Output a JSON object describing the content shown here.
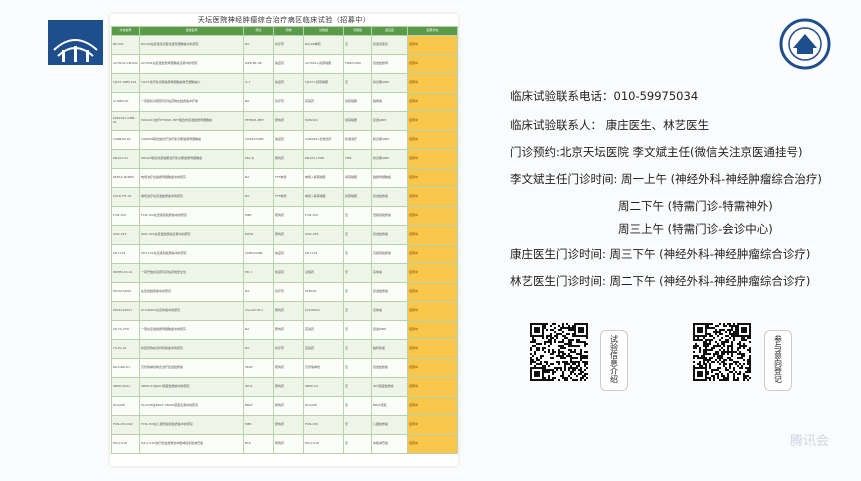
{
  "doc": {
    "title": "天坛医院神经肿瘤综合治疗病区临床试验（招募中）",
    "header_cols": [
      "方案编号",
      "试验名称",
      "靶点",
      "药物",
      "试验组",
      "对照组",
      "适应症",
      "招募状态"
    ],
    "rows": [
      [
        "NP-001",
        "RA106在复发性间变性星形细胞瘤中的研究",
        "NA",
        "化疗药",
        "RA106单药",
        "无",
        "复发间变性",
        "招募中"
      ],
      [
        "ACTOO1-CN-002",
        "ACT001在复发胶质母细胞瘤患者中的研究",
        "IKKβ,NF-κB",
        "免疫药",
        "ACT001+替莫唑胺",
        "TMZ/CCNU",
        "复发胶质母",
        "招募中"
      ],
      [
        "TJ107-GBM-201",
        "TJ107治疗新诊断胶质母细胞瘤淋巴细胞减少",
        "IL-7",
        "免疫药",
        "TJ107+替莫唑胺",
        "无",
        "新诊断GBM",
        "招募中"
      ],
      [
        "LY-GBM-01",
        "一项随机对照研究评估药物在胶质瘤中疗效",
        "NA",
        "化疗药",
        "实验药",
        "替莫唑胺",
        "胶质瘤",
        "招募中"
      ],
      [
        "PLB1001-GBM-01",
        "PLB1001治疗PTPRZ1-MET融合的复发胶质母细胞瘤",
        "PTPRZ1-MET",
        "靶向药",
        "PLB1001",
        "替莫唑胺",
        "复发GBM",
        "招募中"
      ],
      [
        "CANBAN-02",
        "CAN008联合放化疗治疗新诊断胶质母细胞瘤",
        "CD95/CD95L",
        "免疫药",
        "CAN008+标准治疗",
        "标准治疗",
        "新诊断GBM",
        "招募中"
      ],
      [
        "DB102-01",
        "DB102联合替莫唑胺治疗新诊断胶质母细胞瘤",
        "PKC-β",
        "靶向药",
        "DB102+TMZ",
        "TMZ",
        "新诊断GBM",
        "招募中"
      ],
      [
        "PKHLS-RCDRV",
        "电场治疗在胶质母细胞瘤中的研究",
        "NA",
        "TTF电场",
        "电场+替莫唑胺",
        "替莫唑胺",
        "胶质母细胞瘤",
        "招募中"
      ],
      [
        "2018-TTF-01",
        "电场治疗在复发胶质瘤中的研究",
        "NA",
        "TTF电场",
        "电场+替莫唑胺",
        "替莫唑胺",
        "复发胶质瘤",
        "招募中"
      ],
      [
        "FCN-159",
        "FCN-159在低级别胶质瘤中的研究",
        "MEK",
        "靶向药",
        "FCN-159",
        "无",
        "低级别胶质瘤",
        "招募中"
      ],
      [
        "GNC-015",
        "GNC-035在复发胶质瘤患者中的研究",
        "EGFR",
        "靶向药",
        "GNC-035",
        "无",
        "复发胶质瘤",
        "招募中"
      ],
      [
        "SDT-101",
        "SDT-101在高级别胶质瘤中的研究",
        "CD80/CD86",
        "免疫药",
        "SDT-101",
        "无",
        "高级别胶质瘤",
        "招募中"
      ],
      [
        "PWHM-03-01",
        "一项开放标签研究评估药物安全性",
        "PD-1",
        "免疫药",
        "试验药",
        "无",
        "实体瘤",
        "招募中"
      ],
      [
        "WLHA-TRAN",
        "在复发胶质瘤中的研究",
        "NA",
        "化疗药",
        "STB401",
        "无",
        "复发胶质瘤",
        "招募中"
      ],
      [
        "KPCKY10001",
        "KY100001在实体瘤中的研究",
        "Claudin18.2",
        "靶向药",
        "KY100001",
        "无",
        "实体瘤",
        "招募中"
      ],
      [
        "AP-7C-CTD",
        "一项在复发胶质母细胞瘤中的研究",
        "NA",
        "靶向药",
        "实验药",
        "无",
        "复发GBM",
        "招募中"
      ],
      [
        "YS-ZL-01",
        "新型药物在颅内转移瘤中的研究",
        "NA",
        "化疗药",
        "实验药",
        "无",
        "脑转移瘤",
        "招募中"
      ],
      [
        "BG-DRG-01",
        "贝伐珠单抗联合治疗复发胶质瘤",
        "VEGF",
        "靶向药",
        "贝伐珠单抗",
        "无",
        "复发胶质瘤",
        "招募中"
      ],
      [
        "ABSD-0001",
        "ABSD-01在IDH突变胶质瘤中的研究",
        "IDH1",
        "靶向药",
        "ABSD-01",
        "无",
        "IDH突变胶质瘤",
        "招募中"
      ],
      [
        "HLX208",
        "HLX208在BRAF V600E突变患者中的研究",
        "BRAF",
        "靶向药",
        "HLX208",
        "无",
        "BRAF突变",
        "招募中"
      ],
      [
        "FCN-159-002",
        "FCN-159在儿童低级别胶质瘤中的研究",
        "MEK",
        "靶向药",
        "FCN-159",
        "无",
        "儿童胶质瘤",
        "招募中"
      ],
      [
        "HZ-A-018",
        "HZ-A-018治疗复发或难治中枢神经系统淋巴瘤",
        "BTK",
        "靶向药",
        "HZ-A-018",
        "无",
        "中枢淋巴瘤",
        "招募中"
      ]
    ]
  },
  "contact": {
    "phone": "临床试验联系电话：010-59975034",
    "contacts": "临床试验联系人：   康庄医生、林艺医生",
    "appointment": "门诊预约:北京天坛医院 李文斌主任(微信关注京医通挂号)",
    "li_line1": "李文斌主任门诊时间:   周一上午   (神经外科-神经肿瘤综合治疗)",
    "li_line2": "周二下午   (特需门诊-特需神外)",
    "li_line3": "周三上午   (特需门诊-会诊中心)",
    "kang_line": "康庄医生门诊时间:   周三下午   (神经外科-神经肿瘤综合诊疗)",
    "lin_line": "林艺医生门诊时间:   周二下午   (神经外科-神经肿瘤综合诊疗)"
  },
  "qr": {
    "left_label": "试验信息介绍",
    "right_label": "参与意向登记"
  },
  "watermark": "腾讯会",
  "colors": {
    "header": "#5a9a4a",
    "status": "#f8c64a",
    "accent": "#1f4e8c"
  }
}
